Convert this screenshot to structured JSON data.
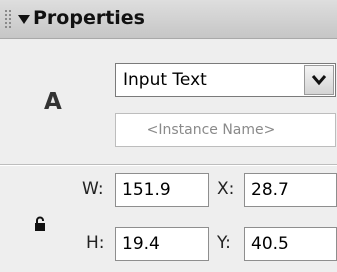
{
  "panel": {
    "title": "Properties",
    "collapse_icon": "triangle-down-icon",
    "grip_icon": "grip-handle-icon"
  },
  "symbol": {
    "type_icon_label": "A"
  },
  "text_type": {
    "selected": "Input Text",
    "dropdown_icon": "chevron-down-icon"
  },
  "instance_name": {
    "placeholder": "<Instance Name>"
  },
  "dimensions": {
    "lock_icon": "lock-icon",
    "w_label": "W:",
    "w_value": "151.9",
    "h_label": "H:",
    "h_value": "19.4",
    "x_label": "X:",
    "x_value": "28.7",
    "y_label": "Y:",
    "y_value": "40.5"
  }
}
